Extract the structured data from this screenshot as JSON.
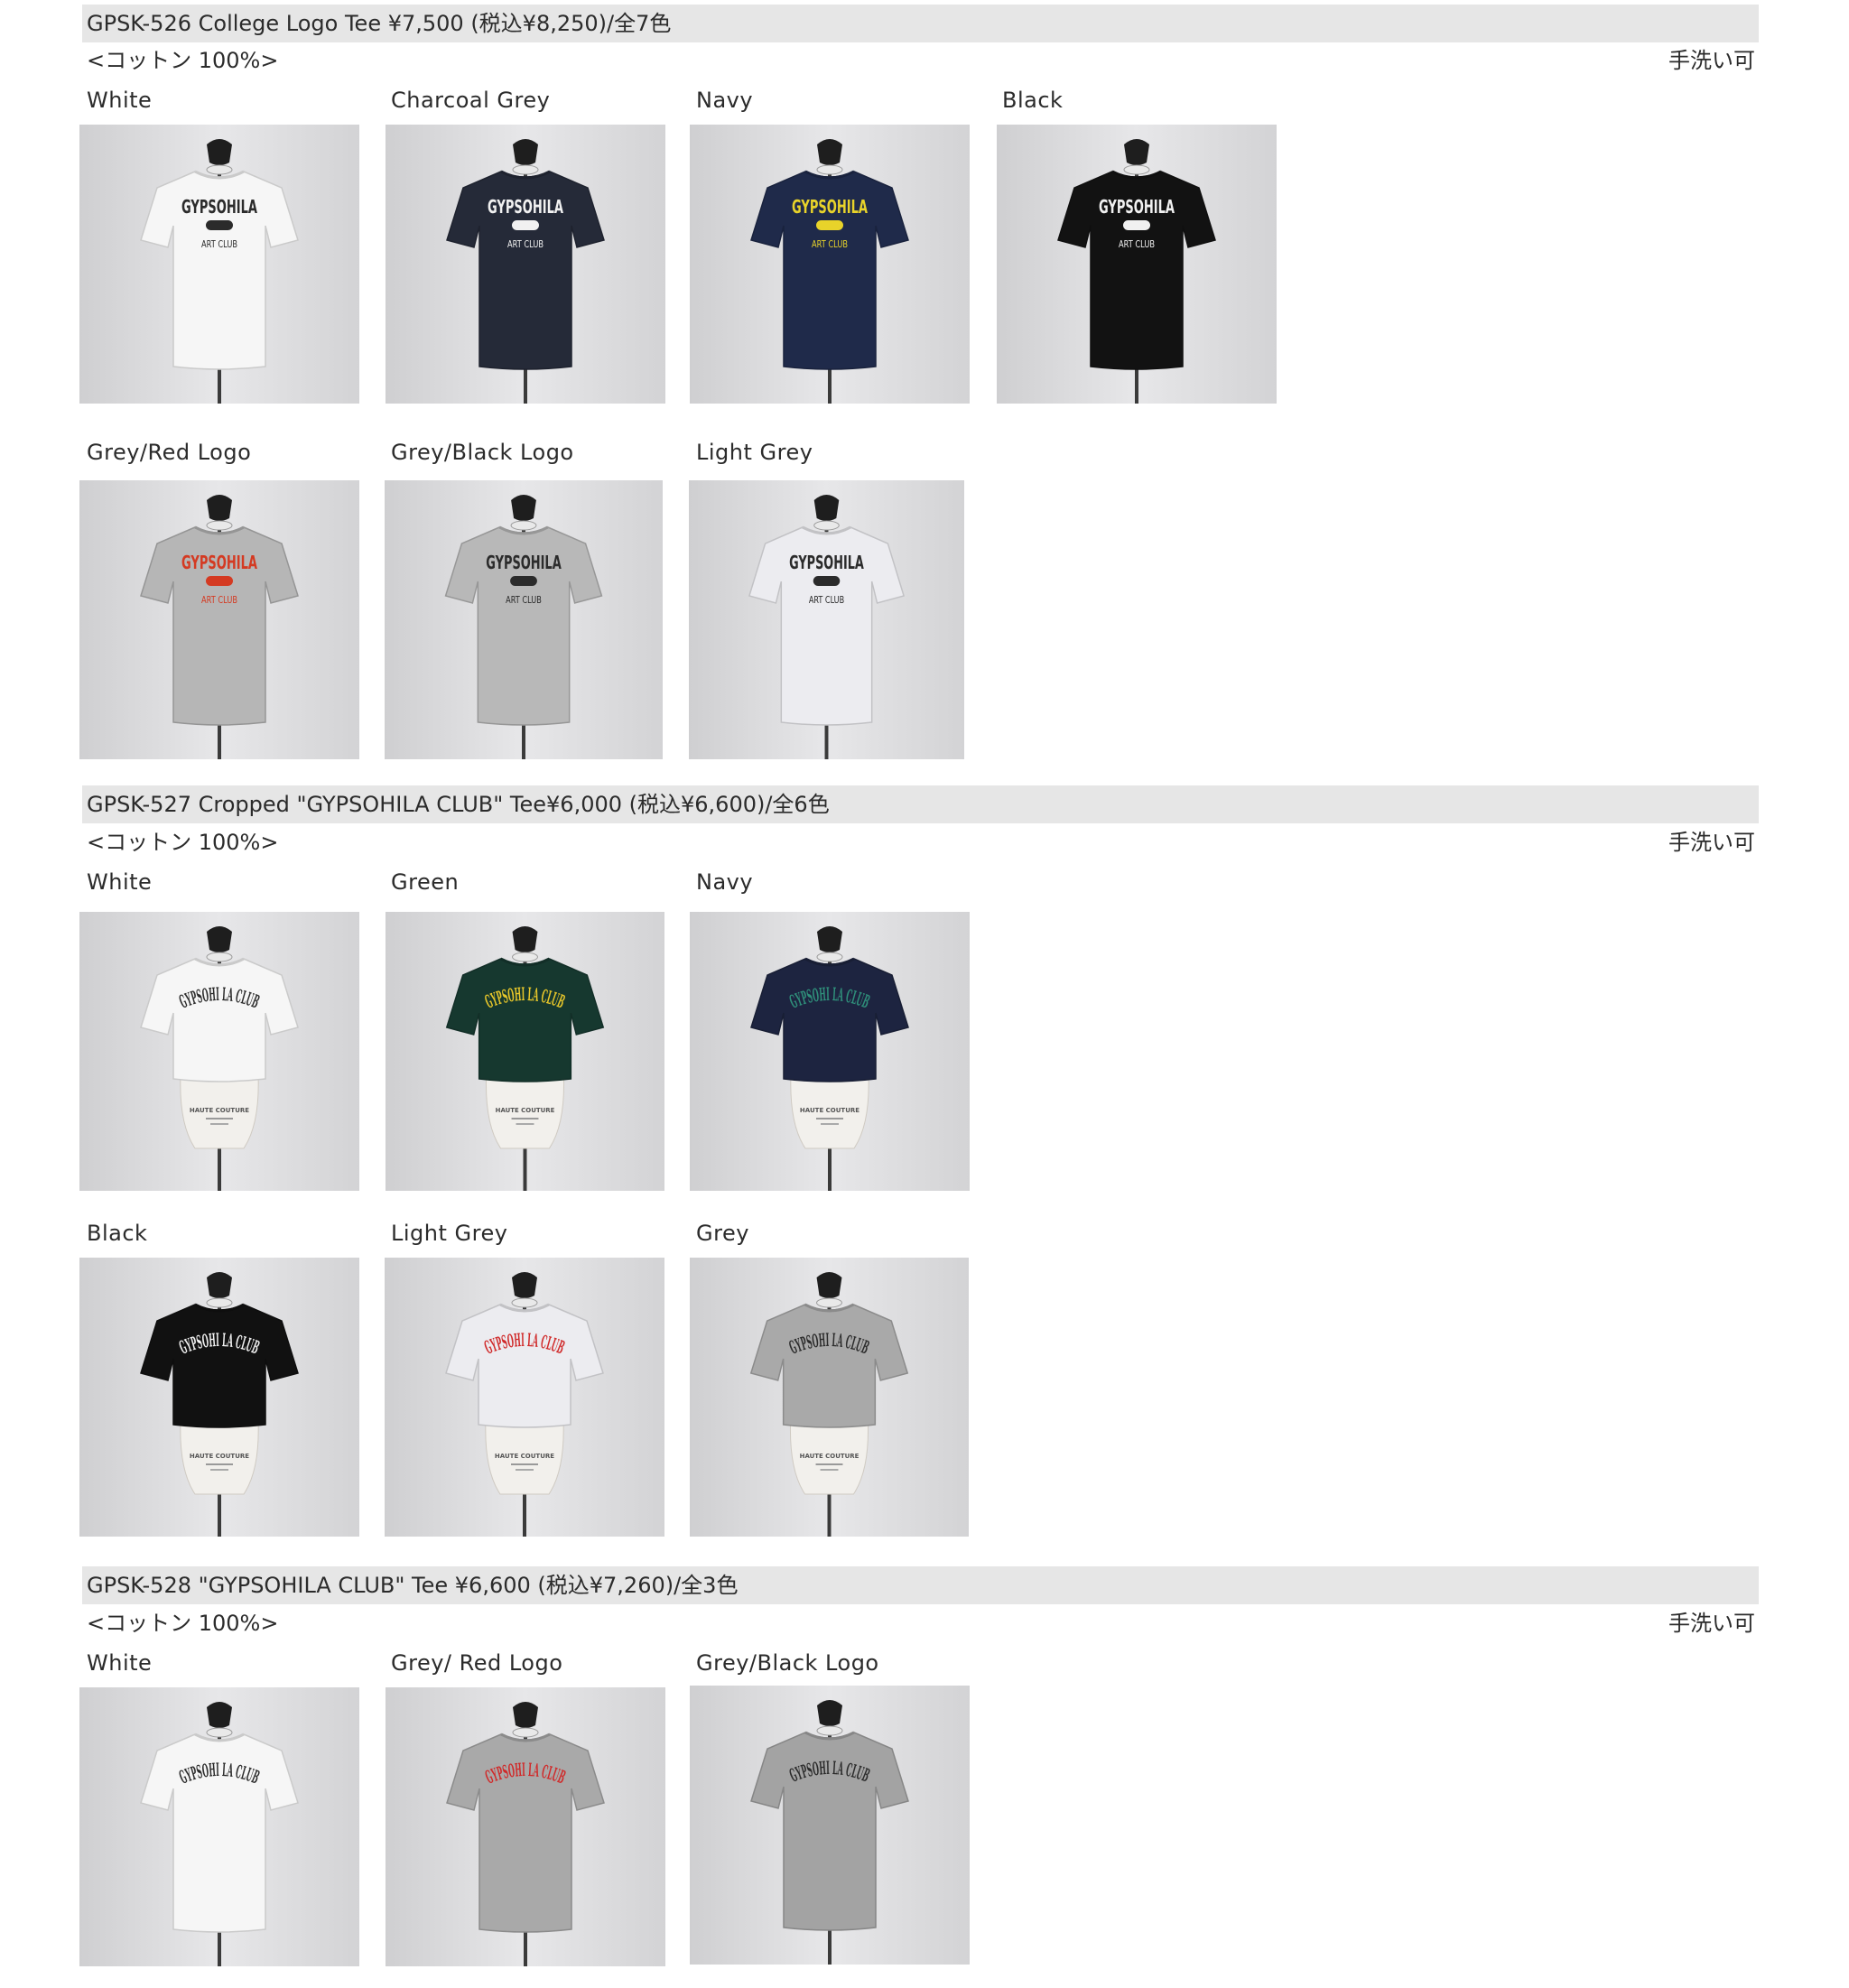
{
  "sections": [
    {
      "header": "GPSK-526  College Logo Tee ¥7,500 (税込¥8,250)/全7色",
      "material": "<コットン 100%>",
      "care": "手洗い可",
      "items": [
        {
          "label": "White",
          "shirt": "#f6f6f6",
          "print": "#2b2b2b",
          "pill": "#2b2b2b",
          "style": "college",
          "cropped": false,
          "logo_text": "GYPSOHILA",
          "sub_text": "ART CLUB"
        },
        {
          "label": "Charcoal Grey",
          "shirt": "#252a38",
          "print": "#f1f1f1",
          "pill": "#f1f1f1",
          "style": "college",
          "cropped": false,
          "logo_text": "GYPSOHILA",
          "sub_text": "ART CLUB"
        },
        {
          "label": "Navy",
          "shirt": "#1f2a4a",
          "print": "#e8d32a",
          "pill": "#e8d32a",
          "style": "college",
          "cropped": false,
          "logo_text": "GYPSOHILA",
          "sub_text": "ART CLUB"
        },
        {
          "label": "Black",
          "shirt": "#121212",
          "print": "#f1f1f1",
          "pill": "#f1f1f1",
          "style": "college",
          "cropped": false,
          "logo_text": "GYPSOHILA",
          "sub_text": "ART CLUB"
        },
        {
          "label": "Grey/Red Logo",
          "shirt": "#b6b6b6",
          "print": "#d43a22",
          "pill": "#d43a22",
          "style": "college",
          "cropped": false,
          "logo_text": "GYPSOHILA",
          "sub_text": "ART CLUB"
        },
        {
          "label": "Grey/Black Logo",
          "shirt": "#b8b8b8",
          "print": "#2b2b2b",
          "pill": "#2b2b2b",
          "style": "college",
          "cropped": false,
          "logo_text": "GYPSOHILA",
          "sub_text": "ART CLUB"
        },
        {
          "label": "Light Grey",
          "shirt": "#ececf0",
          "print": "#2b2b2b",
          "pill": "#2b2b2b",
          "style": "college",
          "cropped": false,
          "logo_text": "GYPSOHILA",
          "sub_text": "ART CLUB"
        }
      ]
    },
    {
      "header": "GPSK-527 Cropped \"GYPSOHILA CLUB\" Tee¥6,000 (税込¥6,600)/全6色",
      "material": "<コットン 100%>",
      "care": "手洗い可",
      "items": [
        {
          "label": "White",
          "shirt": "#f6f6f6",
          "print": "#2b2b2b",
          "style": "arc",
          "cropped": true,
          "logo_text": "GYPSOHI LA CLUB",
          "form_text": "HAUTE COUTURE"
        },
        {
          "label": "Green",
          "shirt": "#16382f",
          "print": "#e8c72a",
          "style": "arc",
          "cropped": true,
          "logo_text": "GYPSOHI LA CLUB",
          "form_text": "HAUTE COUTURE"
        },
        {
          "label": "Navy",
          "shirt": "#1d2440",
          "print": "#2f8f7a",
          "style": "arc",
          "cropped": true,
          "logo_text": "GYPSOHI LA CLUB",
          "form_text": "HAUTE COUTURE"
        },
        {
          "label": "Black",
          "shirt": "#111111",
          "print": "#f1f1f1",
          "style": "arc",
          "cropped": true,
          "logo_text": "GYPSOHI LA CLUB",
          "form_text": "HAUTE COUTURE"
        },
        {
          "label": "Light Grey",
          "shirt": "#ececf0",
          "print": "#d02a2a",
          "style": "arc",
          "cropped": true,
          "logo_text": "GYPSOHI LA CLUB",
          "form_text": "HAUTE COUTURE"
        },
        {
          "label": "Grey",
          "shirt": "#a9a9a9",
          "print": "#2b2b2b",
          "style": "arc",
          "cropped": true,
          "logo_text": "GYPSOHI LA CLUB",
          "form_text": "HAUTE COUTURE"
        }
      ]
    },
    {
      "header": "GPSK-528 \"GYPSOHILA CLUB\" Tee ¥6,600 (税込¥7,260)/全3色",
      "material": "<コットン 100%>",
      "care": "手洗い可",
      "items": [
        {
          "label": "White",
          "shirt": "#f6f6f6",
          "print": "#2b2b2b",
          "style": "arc",
          "cropped": false,
          "logo_text": "GYPSOHI LA CLUB"
        },
        {
          "label": "Grey/ Red Logo",
          "shirt": "#a9a9a9",
          "print": "#d02a2a",
          "style": "arc",
          "cropped": false,
          "logo_text": "GYPSOHI LA CLUB"
        },
        {
          "label": "Grey/Black Logo",
          "shirt": "#a3a3a3",
          "print": "#2b2b2b",
          "style": "arc",
          "cropped": false,
          "logo_text": "GYPSOHI LA CLUB"
        }
      ]
    }
  ]
}
